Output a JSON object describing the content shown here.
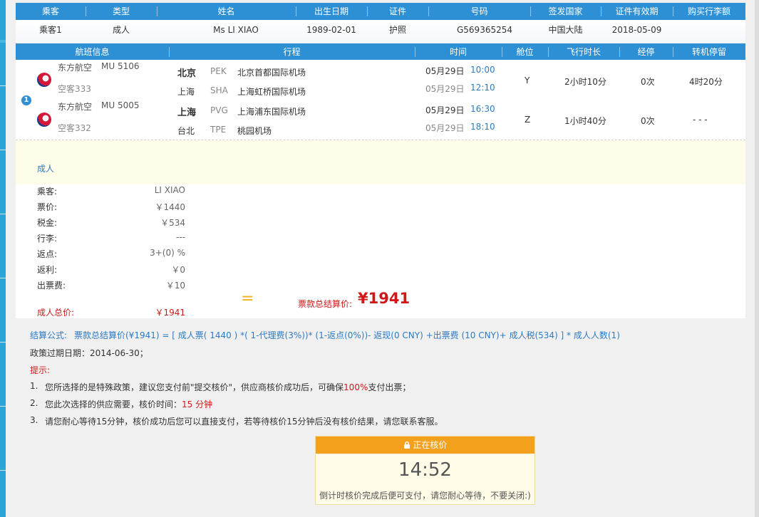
{
  "passenger_header": [
    "乘客",
    "类型",
    "姓名",
    "出生日期",
    "证件",
    "号码",
    "签发国家",
    "证件有效期",
    "购买行李额"
  ],
  "passenger_row": [
    "乘客1",
    "成人",
    "Ms LI XIAO",
    "1989-02-01",
    "护照",
    "G569365254",
    "中国大陆",
    "2018-05-09",
    ""
  ],
  "flight_header": [
    "航班信息",
    "行程",
    "时间",
    "舱位",
    "飞行时长",
    "经停",
    "转机停留"
  ],
  "segments": [
    {
      "airline": "东方航空",
      "flight_no": "MU  5106",
      "aircraft": "空客333",
      "dep_city": "北京",
      "dep_code": "PEK",
      "dep_airport": "北京首都国际机场",
      "arr_city": "上海",
      "arr_code": "SHA",
      "arr_airport": "上海虹桥国际机场",
      "dep_date": "05月29日",
      "dep_time": "10:00",
      "arr_date": "05月29日",
      "arr_time": "12:10",
      "cabin": "Y",
      "duration": "2小时10分",
      "stops": "0次",
      "transfer": "4时20分"
    },
    {
      "airline": "东方航空",
      "flight_no": "MU  5005",
      "aircraft": "空客332",
      "dep_city": "上海",
      "dep_code": "PVG",
      "dep_airport": "上海浦东国际机场",
      "arr_city": "台北",
      "arr_code": "TPE",
      "arr_airport": "桃园机场",
      "dep_date": "05月29日",
      "dep_time": "16:30",
      "arr_date": "05月29日",
      "arr_time": "18:10",
      "cabin": "Z",
      "duration": "1小时40分",
      "stops": "0次",
      "transfer": "- - -"
    }
  ],
  "route_badge": "1",
  "fare": {
    "type_label": "成人",
    "rows": [
      {
        "label": "乘客:",
        "value": "LI XIAO"
      },
      {
        "label": "票价:",
        "value": "￥1440"
      },
      {
        "label": "税金:",
        "value": "￥534"
      },
      {
        "label": "行李:",
        "value": "---"
      },
      {
        "label": "返点:",
        "value": "3+(0) %"
      },
      {
        "label": "返利:",
        "value": "￥0"
      },
      {
        "label": "出票费:",
        "value": "￥10"
      }
    ],
    "total_label": "成人总价:",
    "total_value": "￥1941",
    "equals": "=",
    "grand_label": "票款总结算价:",
    "grand_value": "¥1941"
  },
  "formula": {
    "label": "结算公式:",
    "text": "票款总结算价(¥1941) = [ 成人票( 1440 ) *( 1-代理费(3%))* (1-返点(0%))- 返现(0 CNY) +出票费 (10 CNY)+ 成人税(534) ] * 成人人数(1)"
  },
  "policy_expiry": "政策过期日期：2014-06-30；",
  "tips_title": "提示:",
  "tips": [
    {
      "num": "1.",
      "pre": "您所选择的是特殊政策，建议您支付前\"提交核价\"，供应商核价成功后，可确保",
      "hl": "100%",
      "post": "支付出票；"
    },
    {
      "num": "2.",
      "pre": "您此次选择的供应需要，核价时间：",
      "hl": "15 分钟",
      "post": ""
    },
    {
      "num": "3.",
      "pre": "请您耐心等待15分钟，核价成功后您可以直接支付，若等待核价15分钟后没有核价结果，请您联系客服。",
      "hl": "",
      "post": ""
    }
  ],
  "verify": {
    "title": "正在核价",
    "countdown": "14:52",
    "note": "倒计时核价完成后便可支付，请您耐心等待，不要关闭:)"
  },
  "colors": {
    "header_blue": "#2d8fd4",
    "price_red": "#d01818",
    "verify_orange": "#f3a11c",
    "link_blue": "#2d7bc4"
  }
}
